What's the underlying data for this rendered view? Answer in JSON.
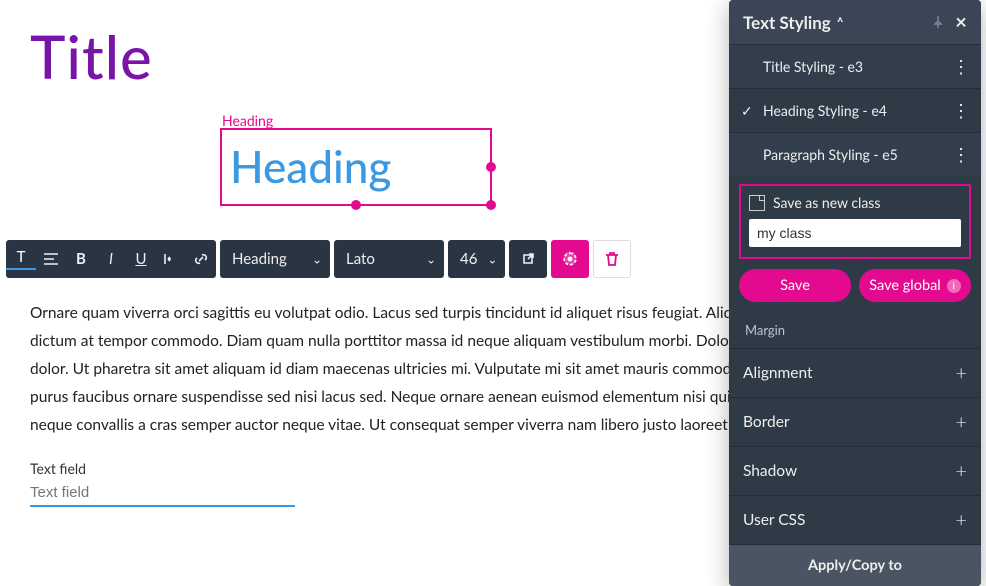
{
  "canvas": {
    "title": "Title",
    "selection_label": "Heading",
    "heading_text": "Heading",
    "paragraph": "Ornare quam viverra orci sagittis eu volutpat odio. Lacus sed turpis tincidunt id aliquet risus feugiat. Aliquet risus feugiat in ante metus dictum at tempor commodo. Diam quam nulla porttitor massa id neque aliquam vestibulum morbi. Dolor magna eget est lorem ipsum dolor. Ut pharetra sit amet aliquam id diam maecenas ultricies mi. Vulputate mi sit amet mauris commodo quis imperdiet massa. Vitae purus faucibus ornare suspendisse sed nisi lacus sed. Neque ornare aenean euismod elementum nisi quis eleifend quam. Facilisis gravida neque convallis a cras semper auctor neque vitae. Ut consequat semper viverra nam libero justo laoreet sit.",
    "text_field_label": "Text field",
    "text_field_placeholder": "Text field"
  },
  "toolbar": {
    "style_select": "Heading",
    "font_select": "Lato",
    "size_select": "46"
  },
  "panel": {
    "title": "Text Styling",
    "classes": [
      {
        "label": "Title Styling - e3",
        "active": false
      },
      {
        "label": "Heading Styling - e4",
        "active": true
      },
      {
        "label": "Paragraph Styling - e5",
        "active": false
      }
    ],
    "save_label": "Save as new class",
    "class_input_value": "my class",
    "btn_save": "Save",
    "btn_save_global": "Save global",
    "truncated_section": "Margin",
    "sections": [
      "Alignment",
      "Border",
      "Shadow",
      "User CSS"
    ],
    "apply_label": "Apply/Copy to"
  },
  "colors": {
    "accent_pink": "#e40a8f",
    "heading_blue": "#3a99e0",
    "title_purple": "#7815a8",
    "panel_bg": "#2f3a47"
  }
}
